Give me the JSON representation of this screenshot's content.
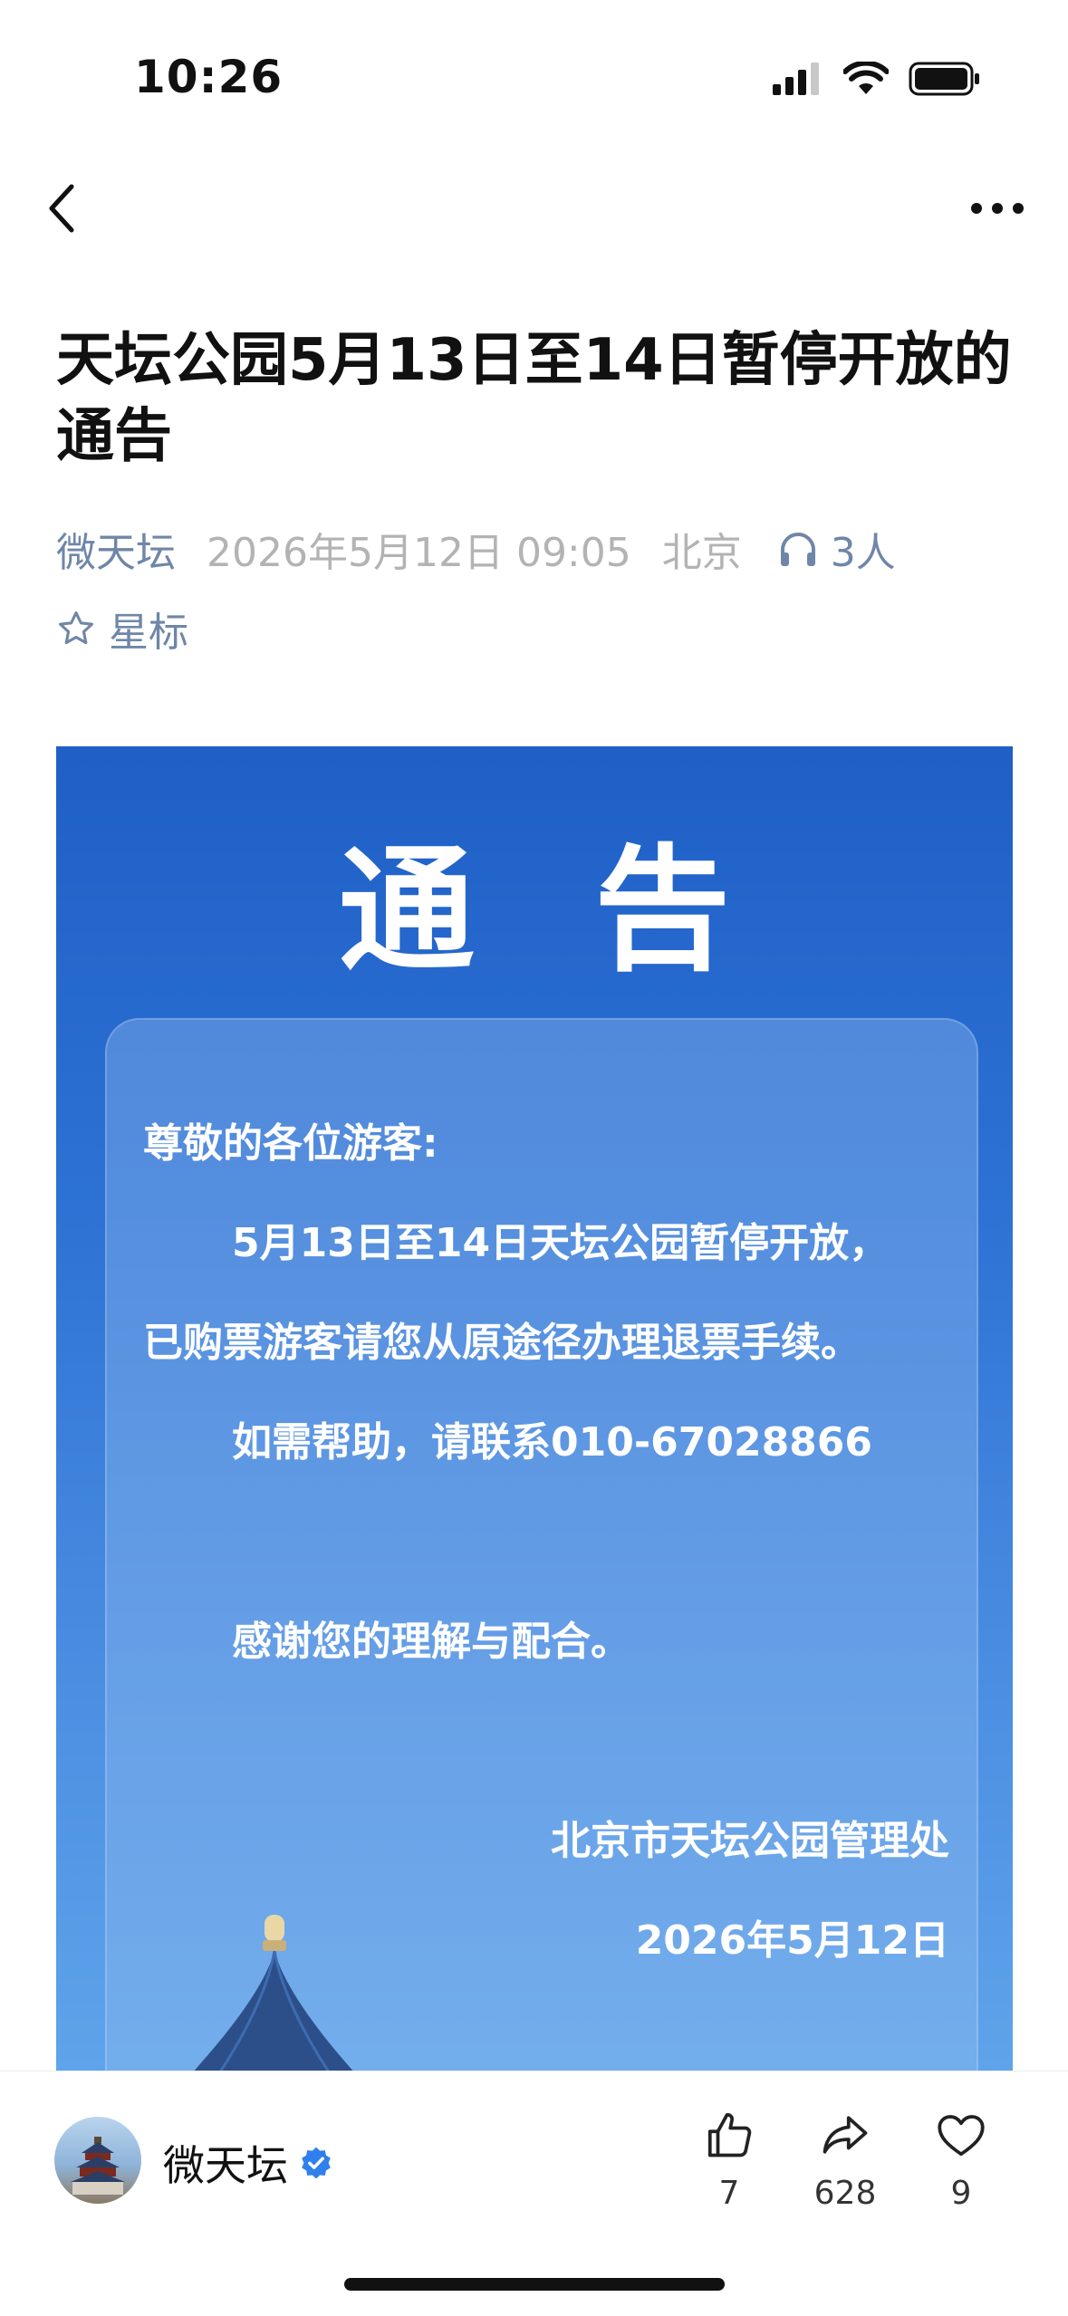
{
  "status_bar": {
    "time": "10:26"
  },
  "article": {
    "title": "天坛公园5月13日至14日暂停开放的通告",
    "author": "微天坛",
    "date": "2026年5月12日 09:05",
    "location": "北京",
    "listeners": "3人",
    "star_label": "星标"
  },
  "poster": {
    "heading": "通 告",
    "greeting": "尊敬的各位游客:",
    "line1": "5月13日至14日天坛公园暂停开放，",
    "line2": "已购票游客请您从原途径办理退票手续。",
    "line3": "如需帮助，请联系010-67028866",
    "line4": "感谢您的理解与配合。",
    "signature": "北京市天坛公园管理处",
    "sign_date": "2026年5月12日"
  },
  "bottom_bar": {
    "author": "微天坛",
    "likes": "7",
    "shares": "628",
    "favorites": "9"
  },
  "colors": {
    "link_blue": "#6f86a8",
    "verified_blue": "#2f80ed",
    "poster_top": "#1f5fc6",
    "poster_bottom": "#5ea4ea"
  }
}
